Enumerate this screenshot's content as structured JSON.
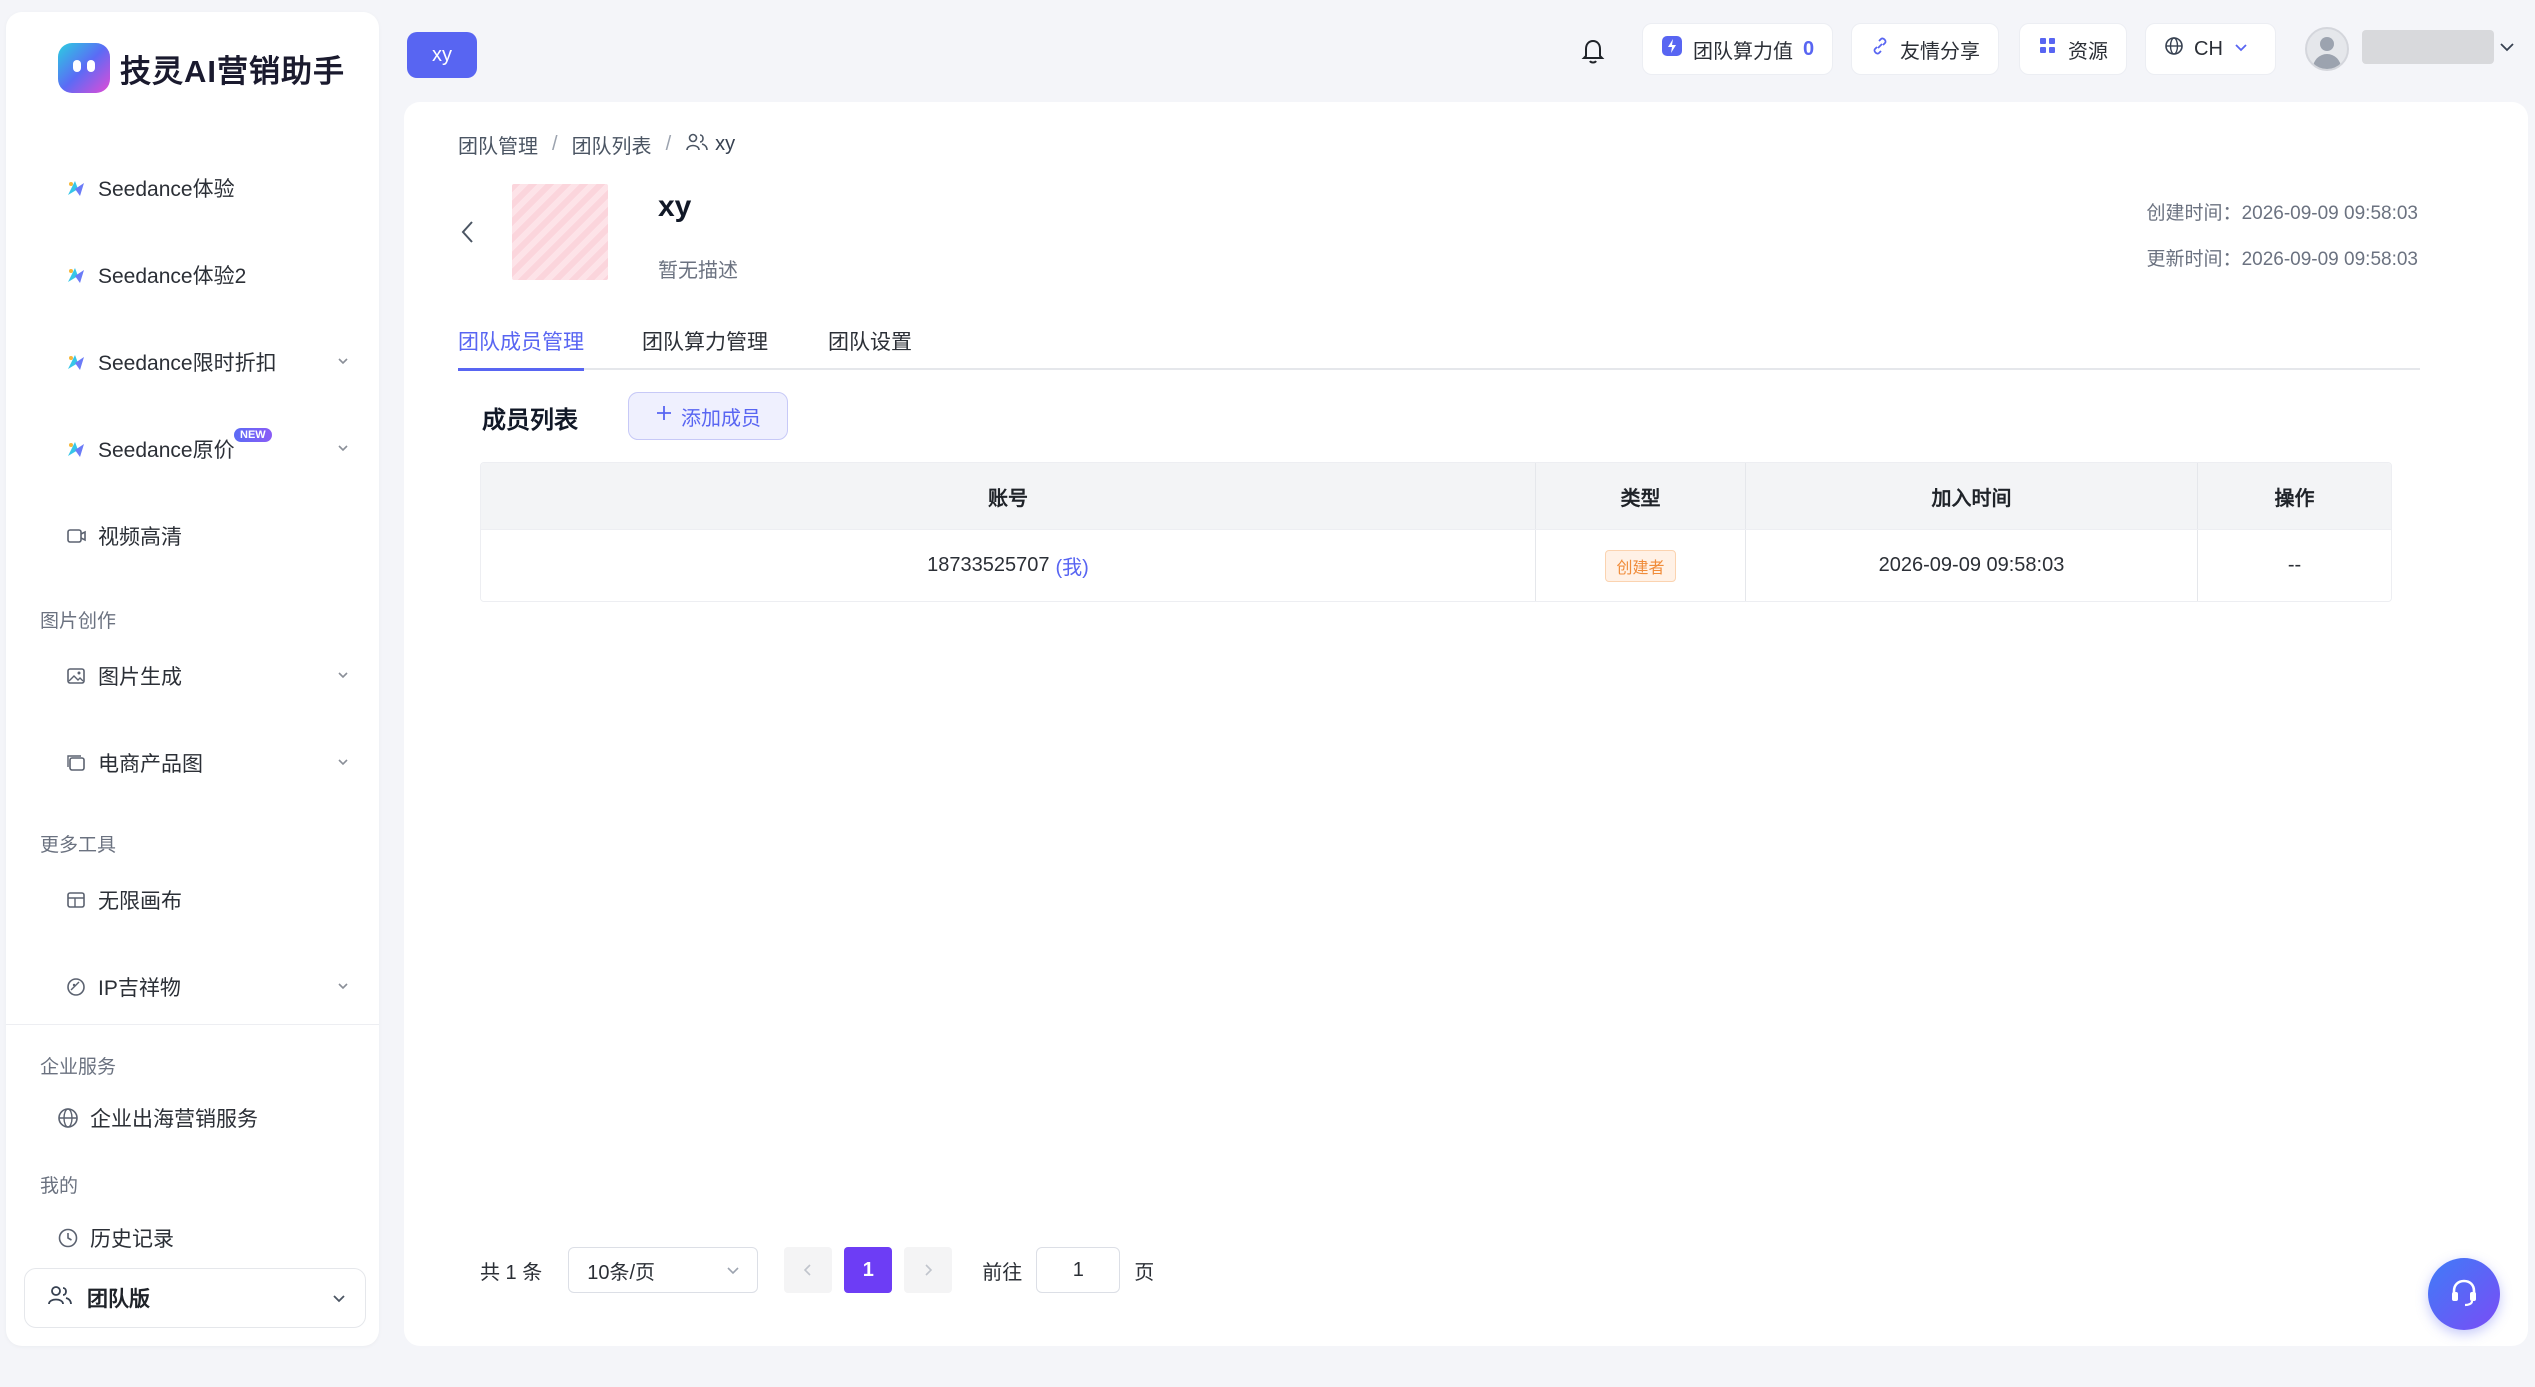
{
  "brand": {
    "name": "技灵AI营销助手"
  },
  "sidebar": {
    "items": [
      {
        "label": "Seedance体验",
        "icon": "seedance-icon",
        "has_chevron": false
      },
      {
        "label": "Seedance体验2",
        "icon": "seedance-icon",
        "has_chevron": false
      },
      {
        "label": "Seedance限时折扣",
        "icon": "seedance-icon",
        "has_chevron": true
      },
      {
        "label": "Seedance原价",
        "icon": "seedance-icon",
        "has_chevron": true,
        "badge": "NEW"
      },
      {
        "label": "视频高清",
        "icon": "video-hd-icon",
        "has_chevron": false
      },
      {
        "label": "图片生成",
        "icon": "image-icon",
        "has_chevron": true
      },
      {
        "label": "电商产品图",
        "icon": "product-image-icon",
        "has_chevron": true
      },
      {
        "label": "无限画布",
        "icon": "canvas-icon",
        "has_chevron": false
      },
      {
        "label": "IP吉祥物",
        "icon": "mascot-icon",
        "has_chevron": true
      },
      {
        "label": "企业出海营销服务",
        "icon": "globe-icon",
        "has_chevron": false
      },
      {
        "label": "历史记录",
        "icon": "history-icon",
        "has_chevron": false
      }
    ],
    "sections": {
      "image_creation": "图片创作",
      "more_tools": "更多工具",
      "enterprise": "企业服务",
      "mine": "我的"
    },
    "team_select": {
      "label": "团队版"
    }
  },
  "topbar": {
    "team_chip": "xy",
    "compute_label": "团队算力值",
    "compute_value": "0",
    "share_label": "友情分享",
    "resources_label": "资源",
    "language": "CH"
  },
  "breadcrumb": {
    "items": [
      "团队管理",
      "团队列表"
    ],
    "current": "xy",
    "separator": "/"
  },
  "team": {
    "name": "xy",
    "description": "暂无描述",
    "created_label": "创建时间：",
    "created_at": "2026-09-09 09:58:03",
    "updated_label": "更新时间：",
    "updated_at": "2026-09-09 09:58:03"
  },
  "tabs": [
    {
      "label": "团队成员管理",
      "active": true
    },
    {
      "label": "团队算力管理",
      "active": false
    },
    {
      "label": "团队设置",
      "active": false
    }
  ],
  "members": {
    "title": "成员列表",
    "add_button": "添加成员",
    "columns": [
      "账号",
      "类型",
      "加入时间",
      "操作"
    ],
    "rows": [
      {
        "account": "18733525707",
        "me_tag": "(我)",
        "type": "创建者",
        "joined": "2026-09-09 09:58:03",
        "actions": "--"
      }
    ]
  },
  "pagination": {
    "total_text": "共 1 条",
    "page_size": "10条/页",
    "current_page": "1",
    "goto_label": "前往",
    "goto_value": "1",
    "page_suffix": "页"
  },
  "colors": {
    "accent": "#5865f2",
    "page_active": "#6d3df5",
    "tag_orange": "#f08c3a"
  }
}
